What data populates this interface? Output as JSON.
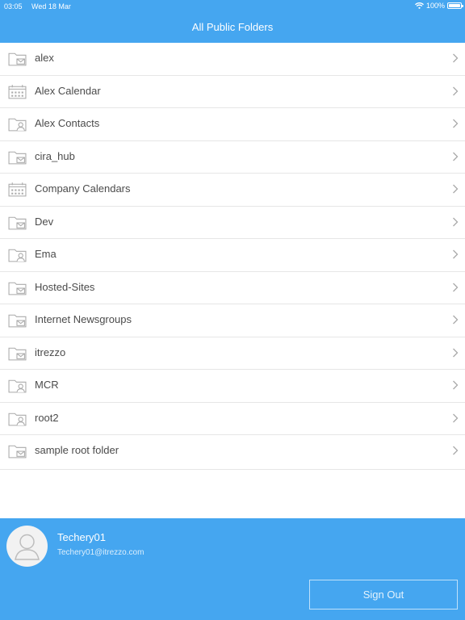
{
  "status_bar": {
    "time": "03:05",
    "date": "Wed 18 Mar",
    "battery": "100%"
  },
  "header": {
    "title": "All Public Folders"
  },
  "folders": [
    {
      "label": "alex",
      "icon": "mail-folder-icon"
    },
    {
      "label": "Alex Calendar",
      "icon": "calendar-folder-icon"
    },
    {
      "label": "Alex Contacts",
      "icon": "contacts-folder-icon"
    },
    {
      "label": "cira_hub",
      "icon": "mail-folder-icon"
    },
    {
      "label": "Company Calendars",
      "icon": "calendar-folder-icon"
    },
    {
      "label": "Dev",
      "icon": "mail-folder-icon"
    },
    {
      "label": "Ema",
      "icon": "contacts-folder-icon"
    },
    {
      "label": "Hosted-Sites",
      "icon": "mail-folder-icon"
    },
    {
      "label": "Internet Newsgroups",
      "icon": "mail-folder-icon"
    },
    {
      "label": "itrezzo",
      "icon": "mail-folder-icon"
    },
    {
      "label": "MCR",
      "icon": "contacts-folder-icon"
    },
    {
      "label": "root2",
      "icon": "contacts-folder-icon"
    },
    {
      "label": "sample root folder",
      "icon": "mail-folder-icon"
    }
  ],
  "user": {
    "name": "Techery01",
    "email": "Techery01@itrezzo.com"
  },
  "sign_out_label": "Sign Out",
  "colors": {
    "accent": "#45a6f0",
    "text": "#4b4b4b",
    "icon": "#a9a9a9"
  }
}
